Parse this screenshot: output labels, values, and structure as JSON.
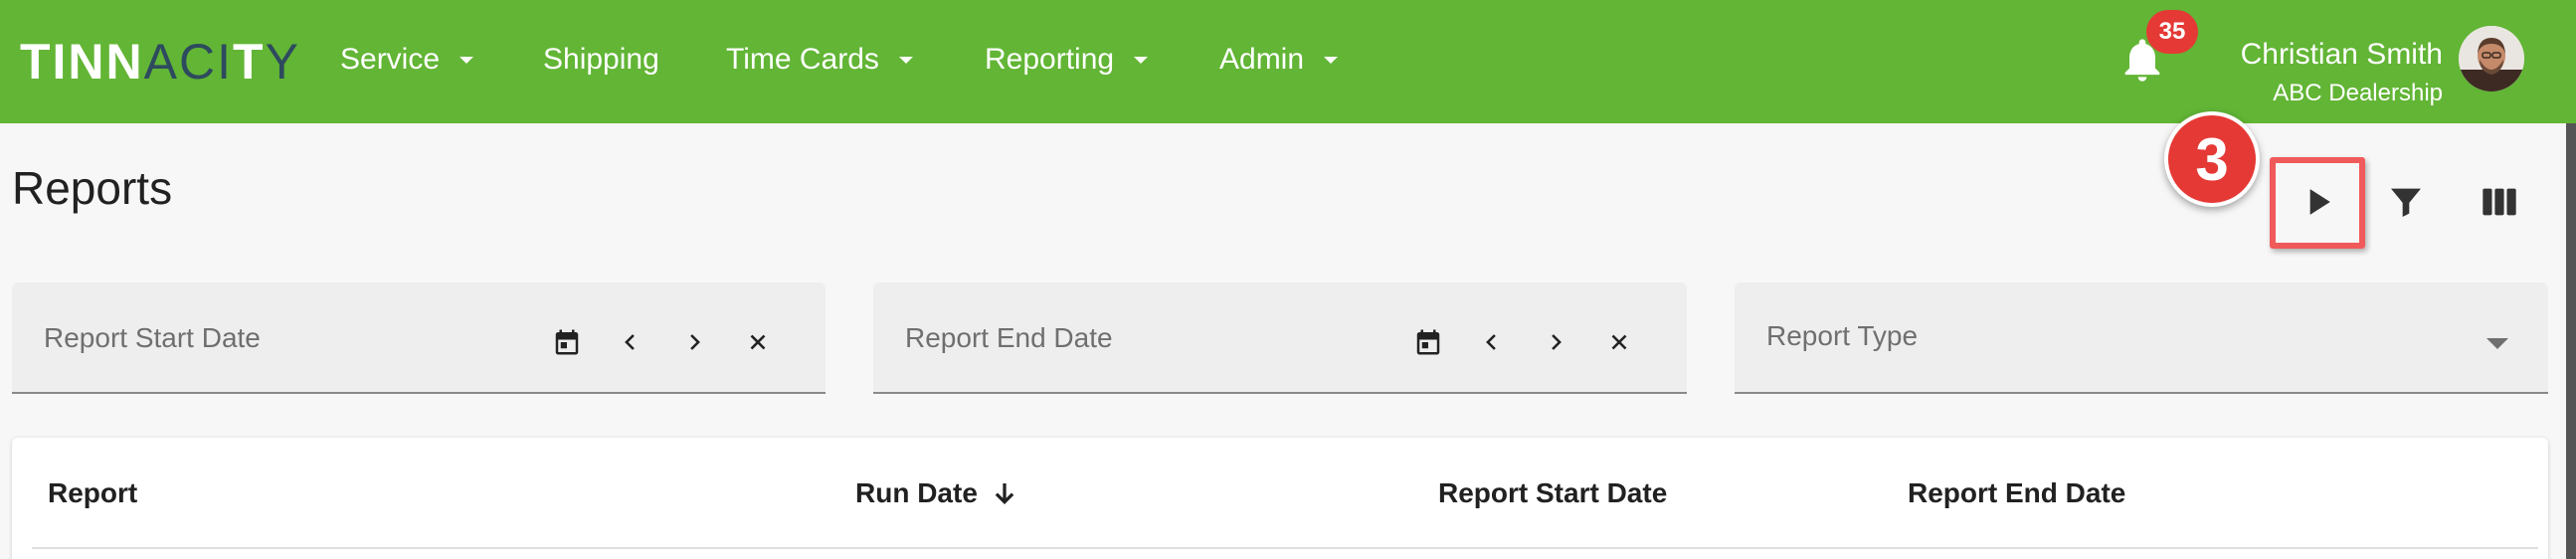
{
  "nav": {
    "logo": {
      "part1": "TINN",
      "part2": "ACI",
      "part3": "T",
      "part4": "Y"
    },
    "items": [
      {
        "label": "Service",
        "has_dropdown": true
      },
      {
        "label": "Shipping",
        "has_dropdown": false
      },
      {
        "label": "Time Cards",
        "has_dropdown": true
      },
      {
        "label": "Reporting",
        "has_dropdown": true
      },
      {
        "label": "Admin",
        "has_dropdown": true
      }
    ],
    "notifications": {
      "count": "35",
      "icon": "bell-icon"
    },
    "user": {
      "name": "Christian Smith",
      "organization": "ABC Dealership"
    }
  },
  "page": {
    "title": "Reports",
    "toolbar": {
      "run_icon": "play-icon",
      "filter_icon": "filter-icon",
      "columns_icon": "columns-icon"
    },
    "step_badge": "3"
  },
  "filters": {
    "start_date": {
      "label": "Report Start Date"
    },
    "end_date": {
      "label": "Report End Date"
    },
    "report_type": {
      "label": "Report Type"
    }
  },
  "table": {
    "headers": [
      "Report",
      "Run Date",
      "Report Start Date",
      "Report End Date"
    ],
    "sorted_column": "Run Date",
    "sort_direction": "descending"
  },
  "colors": {
    "navbar": "#62b535",
    "notification_badge": "#e53935",
    "highlight": "#f05a5a"
  }
}
